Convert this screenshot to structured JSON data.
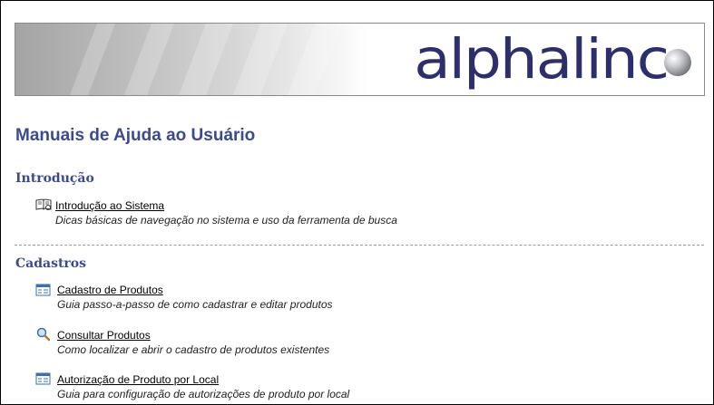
{
  "banner": {
    "logo_text": "alphalin",
    "logo_color": "#2d2f6c"
  },
  "page": {
    "title": "Manuais de Ajuda ao Usuário",
    "title_color": "#3b4a8f"
  },
  "sections": [
    {
      "title": "Introdução",
      "items": [
        {
          "icon": "open-book-icon",
          "label": "Introdução ao Sistema",
          "description": "Dicas básicas de navegação no sistema e uso da ferramenta de busca"
        }
      ]
    },
    {
      "title": "Cadastros",
      "items": [
        {
          "icon": "form-window-icon",
          "label": "Cadastro de Produtos",
          "description": "Guia passo-a-passo de como cadastrar e editar produtos"
        },
        {
          "icon": "magnifier-icon",
          "label": "Consultar Produtos",
          "description": "Como localizar e abrir o cadastro de produtos existentes"
        },
        {
          "icon": "form-window-icon",
          "label": "Autorização de Produto por Local",
          "description": "Guia para configuração de autorizações de produto por local"
        }
      ]
    }
  ]
}
